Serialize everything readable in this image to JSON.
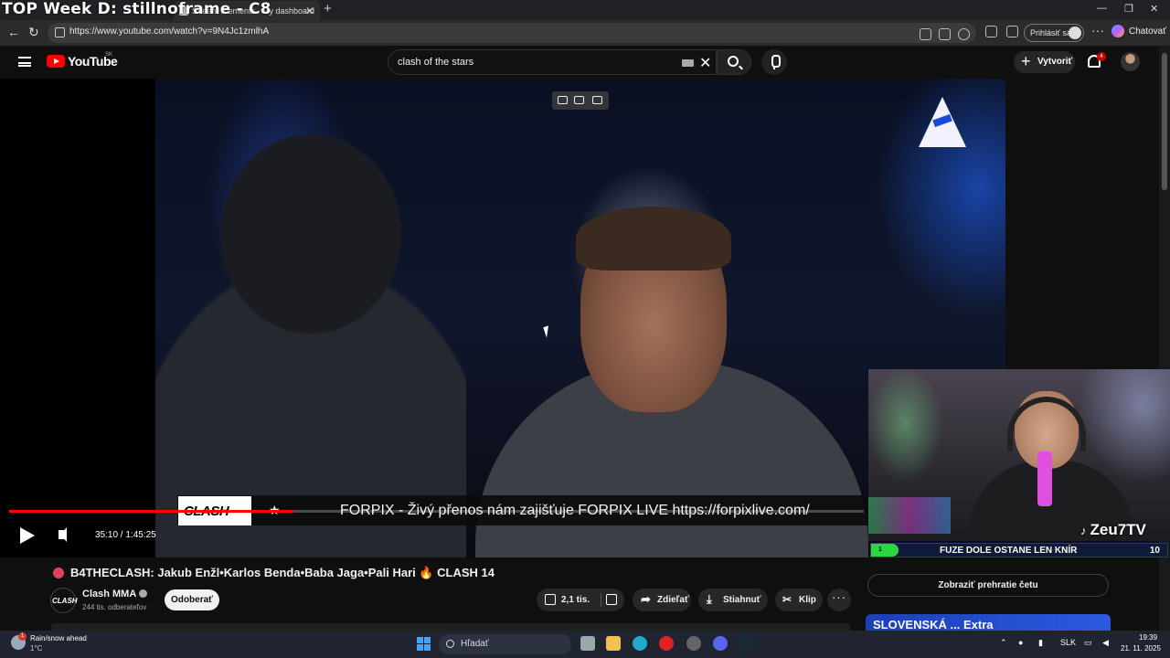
{
  "overlay": {
    "title": "TOP Week D: stillnoframe - C8"
  },
  "browser": {
    "tab_title": "Stream Elements - My dashboard",
    "url": "https://www.youtube.com/watch?v=9N4Jc1zmlhA",
    "signin_label": "Prihlásiť sa",
    "chat_label": "Chatovať"
  },
  "youtube": {
    "logo_text": "YouTube",
    "region": "SK",
    "search_value": "clash of the stars",
    "create_label": "Vytvoriť",
    "notification_count": "4"
  },
  "player": {
    "ticker_logo": "CLASH",
    "ticker_text": "FORPIX - Živý přenos nám zajišťuje FORPIX LIVE https://forpixlive.com/",
    "time": "35:10 / 1:45:25",
    "progress": 0.333
  },
  "webcam": {
    "streamer": "Zeu7TV",
    "poll_label": "FUZE DOLE OSTANE LEN KNÍR",
    "poll_left_count": "1",
    "poll_count": "10"
  },
  "video_info": {
    "title": "B4THECLASH: Jakub Enžl•Karlos Benda•Baba Jaga•Pali Hari 🔥 CLASH 14",
    "channel": "Clash MMA",
    "subscribers": "244 tis. odberateľov",
    "subscribe_label": "Odoberať",
    "likes": "2,1 tis.",
    "share_label": "Zdieľať",
    "download_label": "Stiahnuť",
    "clip_label": "Klip",
    "chat_replay_label": "Zobraziť prehratie četu",
    "ad_text": "SLOVENSKÁ ... Extra"
  },
  "taskbar": {
    "weather_line1": "Rain/snow ahead",
    "weather_line2": "1°C",
    "search_label": "Hľadať",
    "lang": "SLK",
    "time": "19:39",
    "date": "21. 11. 2025"
  },
  "colors": {
    "yt_red": "#ff0000",
    "poll_green": "#2bd63e",
    "accent_blue": "#3fa6ff"
  }
}
